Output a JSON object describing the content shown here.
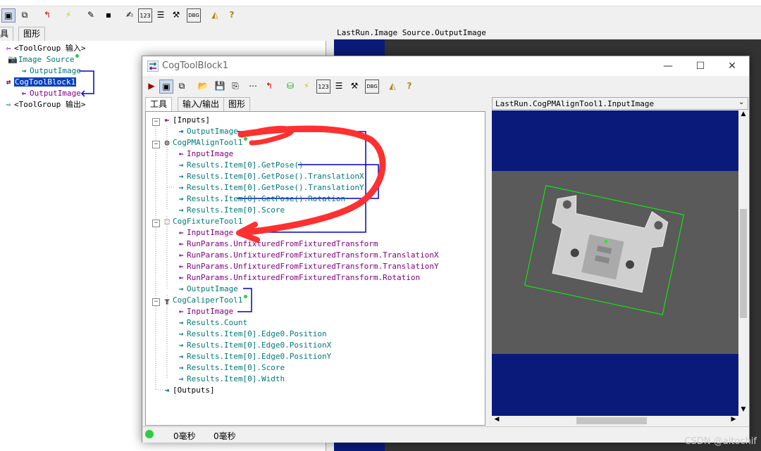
{
  "background_app": {
    "tabs": [
      "具",
      "图形"
    ],
    "tree": [
      {
        "label": "<ToolGroup 输入>",
        "kind": "input-group"
      },
      {
        "label": "Image Source",
        "kind": "tool"
      },
      {
        "label": "OutputImage",
        "kind": "output"
      },
      {
        "label": "CogToolBlock1",
        "kind": "tool-selected"
      },
      {
        "label": "OutputImage",
        "kind": "input"
      },
      {
        "label": "<ToolGroup 输出>",
        "kind": "output-group"
      }
    ],
    "image_title": "LastRun.Image Source.OutputImage"
  },
  "dialog": {
    "title": "CogToolBlock1",
    "window_controls": {
      "minimize": "—",
      "maximize": "☐",
      "close": "✕"
    },
    "tabs": [
      "工具",
      "输入/输出",
      "图形"
    ],
    "tree": {
      "inputs_label": "[Inputs]",
      "inputs_output": "OutputImage",
      "pm_tool": "CogPMAlignTool1",
      "pm_input": "InputImage",
      "pm_outputs": [
        "Results.Item[0].GetPose()",
        "Results.Item[0].GetPose().TranslationX",
        "Results.Item[0].GetPose().TranslationY",
        "Results.Item[0].GetPose().Rotation",
        "Results.Item[0].Score"
      ],
      "fixture_tool": "CogFixtureTool1",
      "fixture_inputs": [
        "InputImage",
        "RunParams.UnfixturedFromFixturedTransform",
        "RunParams.UnfixturedFromFixturedTransform.TranslationX",
        "RunParams.UnfixturedFromFixturedTransform.TranslationY",
        "RunParams.UnfixturedFromFixturedTransform.Rotation"
      ],
      "fixture_output": "OutputImage",
      "caliper_tool": "CogCaliperTool1",
      "caliper_input": "InputImage",
      "caliper_outputs": [
        "Results.Count",
        "Results.Item[0].Edge0.Position",
        "Results.Item[0].Edge0.PositionX",
        "Results.Item[0].Edge0.PositionY",
        "Results.Item[0].Score",
        "Results.Item[0].Width"
      ],
      "outputs_label": "[Outputs]"
    },
    "image_title": "LastRun.CogPMAlignTool1.InputImage",
    "status": {
      "time1": "0毫秒",
      "time2": "0毫秒"
    }
  },
  "watermark": "CSDN @aitochif",
  "colors": {
    "teal": "#007878",
    "purple": "#800080",
    "navy": "#0a1a7a",
    "annotation_red": "#ff3030",
    "link_blue": "#0000cc"
  }
}
